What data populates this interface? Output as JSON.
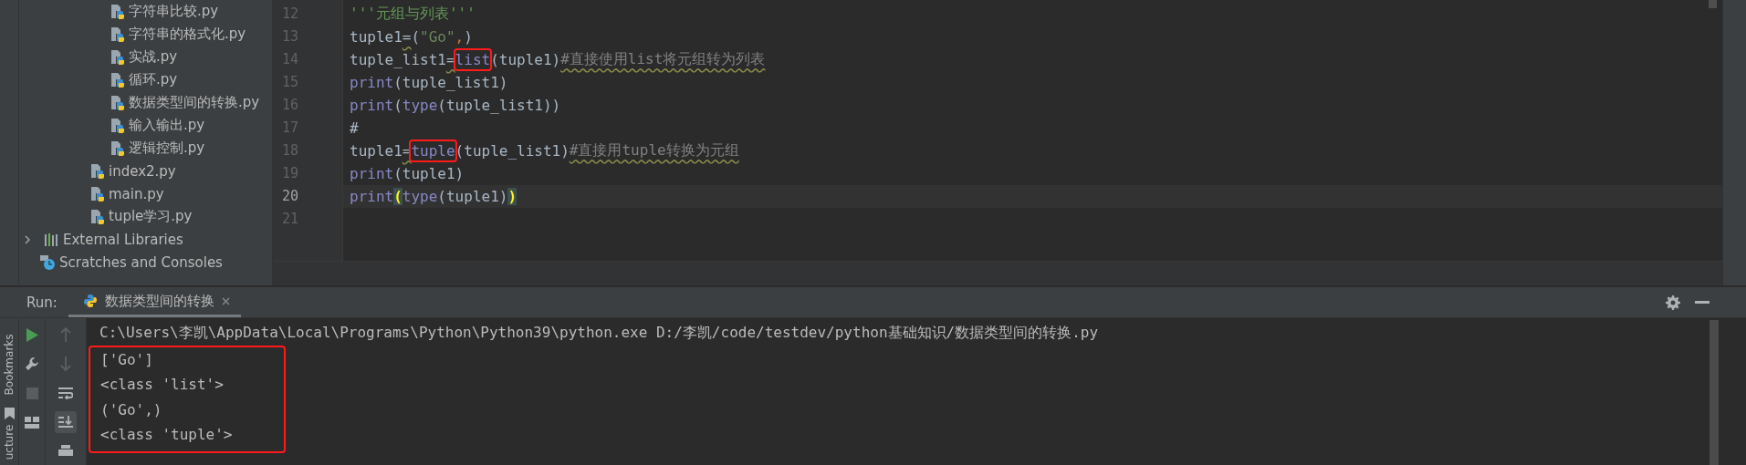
{
  "project_tree": [
    {
      "kind": "group",
      "children": [
        {
          "kind": "file",
          "label": "字符串比较.py"
        },
        {
          "kind": "file",
          "label": "字符串的格式化.py"
        },
        {
          "kind": "file",
          "label": "实战.py"
        },
        {
          "kind": "file",
          "label": "循环.py"
        },
        {
          "kind": "file",
          "label": "数据类型间的转换.py"
        },
        {
          "kind": "file",
          "label": "输入输出.py"
        },
        {
          "kind": "file",
          "label": "逻辑控制.py"
        }
      ]
    },
    {
      "kind": "file",
      "label": "index2.py"
    },
    {
      "kind": "file",
      "label": "main.py"
    },
    {
      "kind": "file",
      "label": "tuple学习.py"
    },
    {
      "kind": "library",
      "label": "External Libraries",
      "expanded": false
    },
    {
      "kind": "scratches",
      "label": "Scratches and Consoles"
    }
  ],
  "editor": {
    "lines": [
      {
        "number": "12",
        "current": false,
        "tokens": [
          {
            "kind": "docstring",
            "text": "'''元组与列表'''"
          }
        ]
      },
      {
        "number": "13",
        "current": false,
        "tokens": [
          {
            "kind": "plain",
            "text": "tuple1"
          },
          {
            "kind": "warn",
            "text": "="
          },
          {
            "kind": "plain",
            "text": "("
          },
          {
            "kind": "string",
            "text": "\"Go\""
          },
          {
            "kind": "punct",
            "text": ","
          },
          {
            "kind": "plain",
            "text": ")"
          }
        ]
      },
      {
        "number": "14",
        "current": false,
        "tokens": [
          {
            "kind": "plain",
            "text": "tuple_list1"
          },
          {
            "kind": "warn",
            "text": "="
          },
          {
            "kind": "builtin",
            "text": "list",
            "boxed": true
          },
          {
            "kind": "plain",
            "text": "(tuple1)"
          },
          {
            "kind": "comment",
            "text": "#直接使用list将元组转为列表"
          }
        ]
      },
      {
        "number": "15",
        "current": false,
        "tokens": [
          {
            "kind": "builtin",
            "text": "print"
          },
          {
            "kind": "plain",
            "text": "(tuple_list1)"
          }
        ]
      },
      {
        "number": "16",
        "current": false,
        "tokens": [
          {
            "kind": "builtin",
            "text": "print"
          },
          {
            "kind": "plain",
            "text": "("
          },
          {
            "kind": "builtin",
            "text": "type"
          },
          {
            "kind": "plain",
            "text": "(tuple_list1))"
          }
        ]
      },
      {
        "number": "17",
        "current": false,
        "tokens": [
          {
            "kind": "plain",
            "text": "#"
          }
        ]
      },
      {
        "number": "18",
        "current": false,
        "tokens": [
          {
            "kind": "plain",
            "text": "tuple1"
          },
          {
            "kind": "warn",
            "text": "="
          },
          {
            "kind": "builtin",
            "text": "tuple",
            "boxed": true
          },
          {
            "kind": "plain",
            "text": "(tuple_list1)"
          },
          {
            "kind": "comment",
            "text": "#直接用tuple转换为元组"
          }
        ]
      },
      {
        "number": "19",
        "current": false,
        "tokens": [
          {
            "kind": "builtin",
            "text": "print"
          },
          {
            "kind": "plain",
            "text": "(tuple1)"
          }
        ]
      },
      {
        "number": "20",
        "current": true,
        "tokens": [
          {
            "kind": "builtin",
            "text": "print"
          },
          {
            "kind": "bracket",
            "text": "("
          },
          {
            "kind": "builtin",
            "text": "type"
          },
          {
            "kind": "plain",
            "text": "(tuple1)"
          },
          {
            "kind": "bracket",
            "text": ")"
          }
        ]
      },
      {
        "number": "21",
        "current": false
      }
    ]
  },
  "run_panel": {
    "title": "Run:",
    "tab": {
      "label": "数据类型间的转换",
      "selected": true
    },
    "command": "C:\\Users\\李凯\\AppData\\Local\\Programs\\Python\\Python39\\python.exe D:/李凯/code/testdev/python基础知识/数据类型间的转换.py",
    "output": {
      "boxed": true,
      "lines": [
        "['Go']",
        "<class 'list'>",
        "('Go',)",
        "<class 'tuple'>"
      ]
    }
  },
  "side_labels": [
    "Bookmarks",
    "ucture"
  ]
}
